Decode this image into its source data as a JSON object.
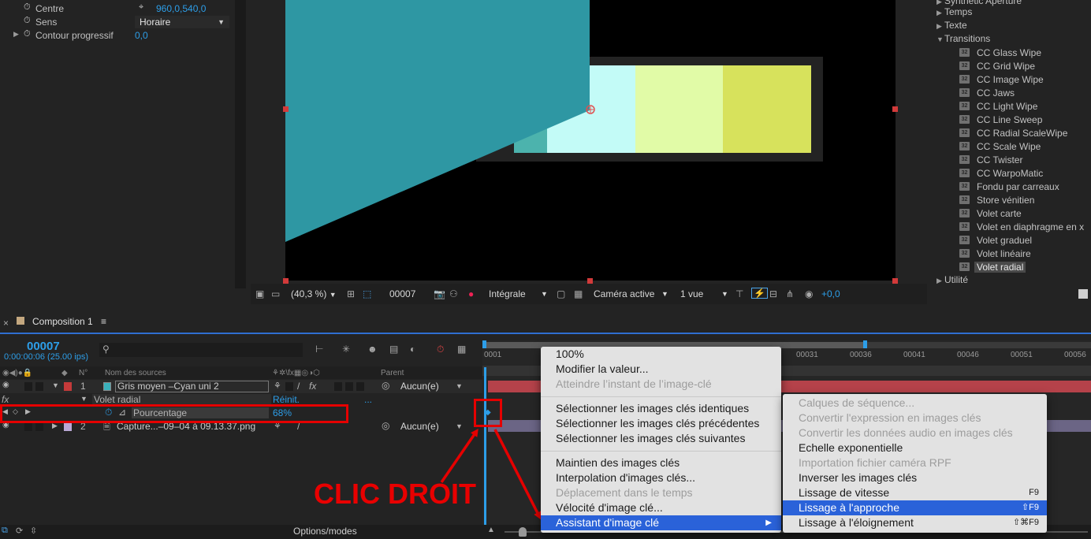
{
  "effect_controls": {
    "properties": [
      {
        "name": "Centre",
        "value": "960,0,540,0"
      },
      {
        "name": "Sens",
        "value": "Horaire"
      },
      {
        "name": "Contour progressif",
        "value": "0,0"
      }
    ]
  },
  "viewer": {
    "zoom": "(40,3 %)",
    "timecode": "00007",
    "resolution": "Intégrale",
    "camera": "Caméra active",
    "views": "1 vue",
    "exposure": "+0,0"
  },
  "presets": {
    "categories": [
      "Synthetic Aperture",
      "Temps",
      "Texte",
      "Transitions"
    ],
    "items": [
      "CC Glass Wipe",
      "CC Grid Wipe",
      "CC Image Wipe",
      "CC Jaws",
      "CC Light Wipe",
      "CC Line Sweep",
      "CC Radial ScaleWipe",
      "CC Scale Wipe",
      "CC Twister",
      "CC WarpoMatic",
      "Fondu par carreaux",
      "Store vénitien",
      "Volet carte",
      "Volet en diaphragme en x",
      "Volet graduel",
      "Volet linéaire",
      "Volet radial"
    ],
    "icon_label": "32",
    "last_category": "Utilité"
  },
  "timeline": {
    "comp_name": "Composition 1",
    "menu_icon": "≡",
    "timecode": "00007",
    "timecode_sub": "0:00:00:06 (25.00 ips)",
    "col_num": "N°",
    "col_source": "Nom des sources",
    "col_parent": "Parent",
    "layer1_num": "1",
    "layer1_name": "Gris moyen –Cyan uni 2",
    "layer1_parent": "Aucun(e)",
    "effect_name": "Volet radial",
    "effect_reset": "Réinit.",
    "effect_dots": "...",
    "fx_label": "fx",
    "prop_name": "Pourcentage",
    "prop_value": "68%",
    "layer2_num": "2",
    "layer2_name": "Capture...–09–04 à 09.13.37.png",
    "layer2_parent": "Aucun(e)",
    "ruler": [
      "0001",
      "00031",
      "00036",
      "00041",
      "00046",
      "00051",
      "00056"
    ],
    "options_modes": "Options/modes"
  },
  "context_menu": {
    "items": [
      {
        "label": "100%",
        "disabled": false
      },
      {
        "label": "Modifier la valeur...",
        "disabled": false
      },
      {
        "label": "Atteindre l’instant de l’image-clé",
        "disabled": true
      },
      {
        "label": "Sélectionner les images clés identiques",
        "disabled": false
      },
      {
        "label": "Sélectionner les images clés précédentes",
        "disabled": false
      },
      {
        "label": "Sélectionner les images clés suivantes",
        "disabled": false
      },
      {
        "label": "Maintien des images clés",
        "disabled": false
      },
      {
        "label": "Interpolation d'images clés...",
        "disabled": false
      },
      {
        "label": "Déplacement dans le temps",
        "disabled": true
      },
      {
        "label": "Vélocité d'image clé...",
        "disabled": false
      },
      {
        "label": "Assistant d'image clé",
        "disabled": false
      }
    ]
  },
  "submenu": {
    "items": [
      {
        "label": "Calques de séquence...",
        "disabled": true,
        "shortcut": ""
      },
      {
        "label": "Convertir l'expression en images clés",
        "disabled": true,
        "shortcut": ""
      },
      {
        "label": "Convertir les données audio en images clés",
        "disabled": true,
        "shortcut": ""
      },
      {
        "label": "Echelle exponentielle",
        "disabled": false,
        "shortcut": ""
      },
      {
        "label": "Importation fichier caméra RPF",
        "disabled": true,
        "shortcut": ""
      },
      {
        "label": "Inverser les images clés",
        "disabled": false,
        "shortcut": ""
      },
      {
        "label": "Lissage de vitesse",
        "disabled": false,
        "shortcut": "F9"
      },
      {
        "label": "Lissage à l'approche",
        "disabled": false,
        "shortcut": "⇧F9"
      },
      {
        "label": "Lissage à l'éloignement",
        "disabled": false,
        "shortcut": "⇧⌘F9"
      }
    ]
  },
  "annotation": "CLIC DROIT",
  "colors": {
    "accent_blue": "#2d9ee8",
    "annotation_red": "#e50000",
    "menu_highlight": "#2a62d9",
    "teal_shape": "#2e97a3",
    "layer_bar_red": "#b5424a"
  }
}
